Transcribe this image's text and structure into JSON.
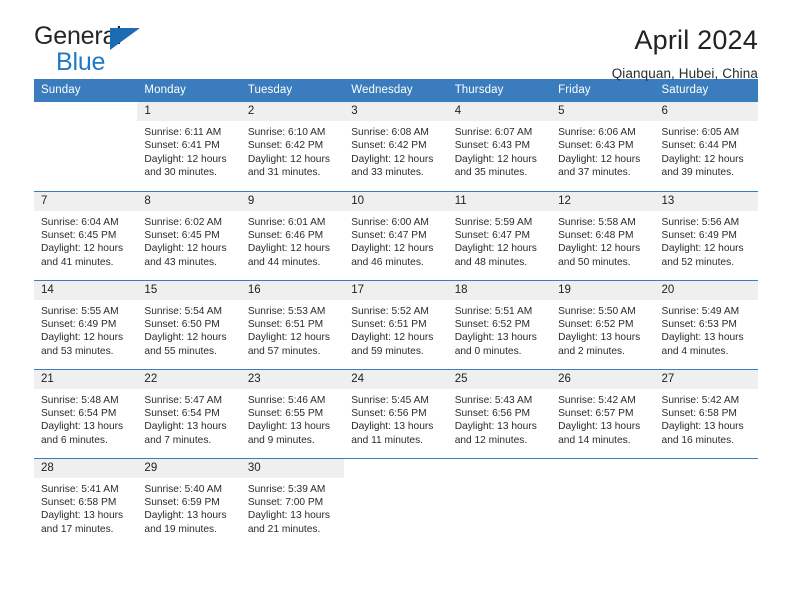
{
  "brand": {
    "name_part1": "General",
    "name_part2": "Blue",
    "triangle_icon": "triangle-icon",
    "colors": {
      "dark": "#262626",
      "blue": "#2079c4",
      "triangle": "#1b6cb5"
    }
  },
  "header": {
    "title": "April 2024",
    "subtitle": "Qianquan, Hubei, China"
  },
  "calendar": {
    "accent_color": "#3a7cbe",
    "daynum_bg": "#efefef",
    "weekdays": [
      "Sunday",
      "Monday",
      "Tuesday",
      "Wednesday",
      "Thursday",
      "Friday",
      "Saturday"
    ],
    "weeks": [
      [
        {
          "day": "",
          "sunrise": "",
          "sunset": "",
          "daylight_line1": "",
          "daylight_line2": ""
        },
        {
          "day": "1",
          "sunrise": "Sunrise: 6:11 AM",
          "sunset": "Sunset: 6:41 PM",
          "daylight_line1": "Daylight: 12 hours",
          "daylight_line2": "and 30 minutes."
        },
        {
          "day": "2",
          "sunrise": "Sunrise: 6:10 AM",
          "sunset": "Sunset: 6:42 PM",
          "daylight_line1": "Daylight: 12 hours",
          "daylight_line2": "and 31 minutes."
        },
        {
          "day": "3",
          "sunrise": "Sunrise: 6:08 AM",
          "sunset": "Sunset: 6:42 PM",
          "daylight_line1": "Daylight: 12 hours",
          "daylight_line2": "and 33 minutes."
        },
        {
          "day": "4",
          "sunrise": "Sunrise: 6:07 AM",
          "sunset": "Sunset: 6:43 PM",
          "daylight_line1": "Daylight: 12 hours",
          "daylight_line2": "and 35 minutes."
        },
        {
          "day": "5",
          "sunrise": "Sunrise: 6:06 AM",
          "sunset": "Sunset: 6:43 PM",
          "daylight_line1": "Daylight: 12 hours",
          "daylight_line2": "and 37 minutes."
        },
        {
          "day": "6",
          "sunrise": "Sunrise: 6:05 AM",
          "sunset": "Sunset: 6:44 PM",
          "daylight_line1": "Daylight: 12 hours",
          "daylight_line2": "and 39 minutes."
        }
      ],
      [
        {
          "day": "7",
          "sunrise": "Sunrise: 6:04 AM",
          "sunset": "Sunset: 6:45 PM",
          "daylight_line1": "Daylight: 12 hours",
          "daylight_line2": "and 41 minutes."
        },
        {
          "day": "8",
          "sunrise": "Sunrise: 6:02 AM",
          "sunset": "Sunset: 6:45 PM",
          "daylight_line1": "Daylight: 12 hours",
          "daylight_line2": "and 43 minutes."
        },
        {
          "day": "9",
          "sunrise": "Sunrise: 6:01 AM",
          "sunset": "Sunset: 6:46 PM",
          "daylight_line1": "Daylight: 12 hours",
          "daylight_line2": "and 44 minutes."
        },
        {
          "day": "10",
          "sunrise": "Sunrise: 6:00 AM",
          "sunset": "Sunset: 6:47 PM",
          "daylight_line1": "Daylight: 12 hours",
          "daylight_line2": "and 46 minutes."
        },
        {
          "day": "11",
          "sunrise": "Sunrise: 5:59 AM",
          "sunset": "Sunset: 6:47 PM",
          "daylight_line1": "Daylight: 12 hours",
          "daylight_line2": "and 48 minutes."
        },
        {
          "day": "12",
          "sunrise": "Sunrise: 5:58 AM",
          "sunset": "Sunset: 6:48 PM",
          "daylight_line1": "Daylight: 12 hours",
          "daylight_line2": "and 50 minutes."
        },
        {
          "day": "13",
          "sunrise": "Sunrise: 5:56 AM",
          "sunset": "Sunset: 6:49 PM",
          "daylight_line1": "Daylight: 12 hours",
          "daylight_line2": "and 52 minutes."
        }
      ],
      [
        {
          "day": "14",
          "sunrise": "Sunrise: 5:55 AM",
          "sunset": "Sunset: 6:49 PM",
          "daylight_line1": "Daylight: 12 hours",
          "daylight_line2": "and 53 minutes."
        },
        {
          "day": "15",
          "sunrise": "Sunrise: 5:54 AM",
          "sunset": "Sunset: 6:50 PM",
          "daylight_line1": "Daylight: 12 hours",
          "daylight_line2": "and 55 minutes."
        },
        {
          "day": "16",
          "sunrise": "Sunrise: 5:53 AM",
          "sunset": "Sunset: 6:51 PM",
          "daylight_line1": "Daylight: 12 hours",
          "daylight_line2": "and 57 minutes."
        },
        {
          "day": "17",
          "sunrise": "Sunrise: 5:52 AM",
          "sunset": "Sunset: 6:51 PM",
          "daylight_line1": "Daylight: 12 hours",
          "daylight_line2": "and 59 minutes."
        },
        {
          "day": "18",
          "sunrise": "Sunrise: 5:51 AM",
          "sunset": "Sunset: 6:52 PM",
          "daylight_line1": "Daylight: 13 hours",
          "daylight_line2": "and 0 minutes."
        },
        {
          "day": "19",
          "sunrise": "Sunrise: 5:50 AM",
          "sunset": "Sunset: 6:52 PM",
          "daylight_line1": "Daylight: 13 hours",
          "daylight_line2": "and 2 minutes."
        },
        {
          "day": "20",
          "sunrise": "Sunrise: 5:49 AM",
          "sunset": "Sunset: 6:53 PM",
          "daylight_line1": "Daylight: 13 hours",
          "daylight_line2": "and 4 minutes."
        }
      ],
      [
        {
          "day": "21",
          "sunrise": "Sunrise: 5:48 AM",
          "sunset": "Sunset: 6:54 PM",
          "daylight_line1": "Daylight: 13 hours",
          "daylight_line2": "and 6 minutes."
        },
        {
          "day": "22",
          "sunrise": "Sunrise: 5:47 AM",
          "sunset": "Sunset: 6:54 PM",
          "daylight_line1": "Daylight: 13 hours",
          "daylight_line2": "and 7 minutes."
        },
        {
          "day": "23",
          "sunrise": "Sunrise: 5:46 AM",
          "sunset": "Sunset: 6:55 PM",
          "daylight_line1": "Daylight: 13 hours",
          "daylight_line2": "and 9 minutes."
        },
        {
          "day": "24",
          "sunrise": "Sunrise: 5:45 AM",
          "sunset": "Sunset: 6:56 PM",
          "daylight_line1": "Daylight: 13 hours",
          "daylight_line2": "and 11 minutes."
        },
        {
          "day": "25",
          "sunrise": "Sunrise: 5:43 AM",
          "sunset": "Sunset: 6:56 PM",
          "daylight_line1": "Daylight: 13 hours",
          "daylight_line2": "and 12 minutes."
        },
        {
          "day": "26",
          "sunrise": "Sunrise: 5:42 AM",
          "sunset": "Sunset: 6:57 PM",
          "daylight_line1": "Daylight: 13 hours",
          "daylight_line2": "and 14 minutes."
        },
        {
          "day": "27",
          "sunrise": "Sunrise: 5:42 AM",
          "sunset": "Sunset: 6:58 PM",
          "daylight_line1": "Daylight: 13 hours",
          "daylight_line2": "and 16 minutes."
        }
      ],
      [
        {
          "day": "28",
          "sunrise": "Sunrise: 5:41 AM",
          "sunset": "Sunset: 6:58 PM",
          "daylight_line1": "Daylight: 13 hours",
          "daylight_line2": "and 17 minutes."
        },
        {
          "day": "29",
          "sunrise": "Sunrise: 5:40 AM",
          "sunset": "Sunset: 6:59 PM",
          "daylight_line1": "Daylight: 13 hours",
          "daylight_line2": "and 19 minutes."
        },
        {
          "day": "30",
          "sunrise": "Sunrise: 5:39 AM",
          "sunset": "Sunset: 7:00 PM",
          "daylight_line1": "Daylight: 13 hours",
          "daylight_line2": "and 21 minutes."
        },
        {
          "day": "",
          "sunrise": "",
          "sunset": "",
          "daylight_line1": "",
          "daylight_line2": ""
        },
        {
          "day": "",
          "sunrise": "",
          "sunset": "",
          "daylight_line1": "",
          "daylight_line2": ""
        },
        {
          "day": "",
          "sunrise": "",
          "sunset": "",
          "daylight_line1": "",
          "daylight_line2": ""
        },
        {
          "day": "",
          "sunrise": "",
          "sunset": "",
          "daylight_line1": "",
          "daylight_line2": ""
        }
      ]
    ]
  }
}
